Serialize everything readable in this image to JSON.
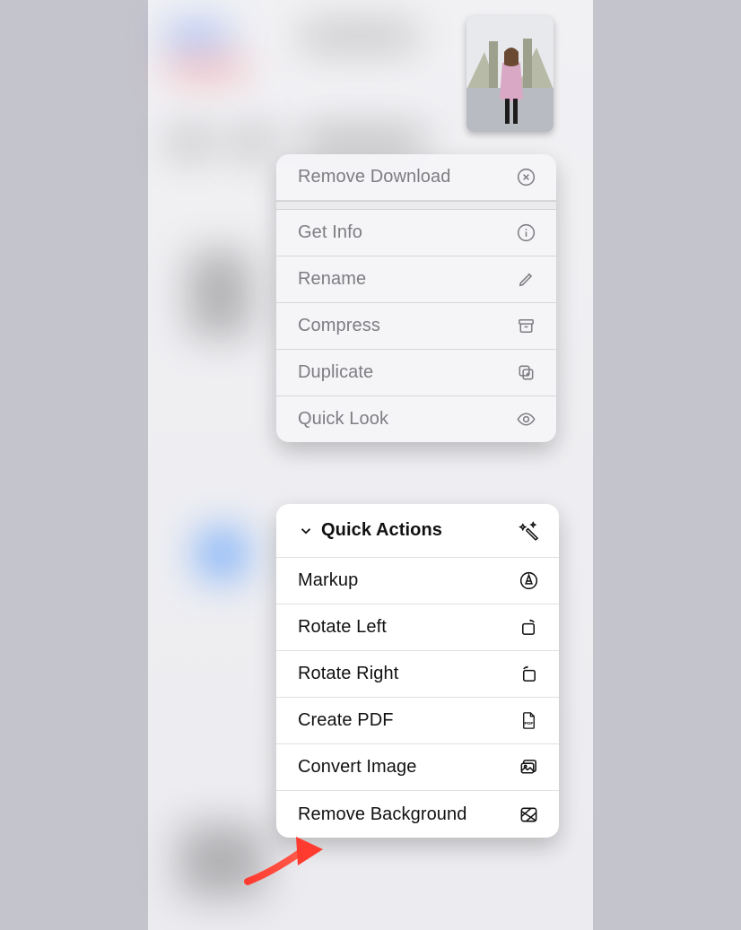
{
  "context_menu": {
    "remove_download": "Remove Download",
    "get_info": "Get Info",
    "rename": "Rename",
    "compress": "Compress",
    "duplicate": "Duplicate",
    "quick_look": "Quick Look"
  },
  "quick_actions": {
    "header": "Quick Actions",
    "markup": "Markup",
    "rotate_left": "Rotate Left",
    "rotate_right": "Rotate Right",
    "create_pdf": "Create PDF",
    "convert_image": "Convert Image",
    "remove_background": "Remove Background"
  }
}
